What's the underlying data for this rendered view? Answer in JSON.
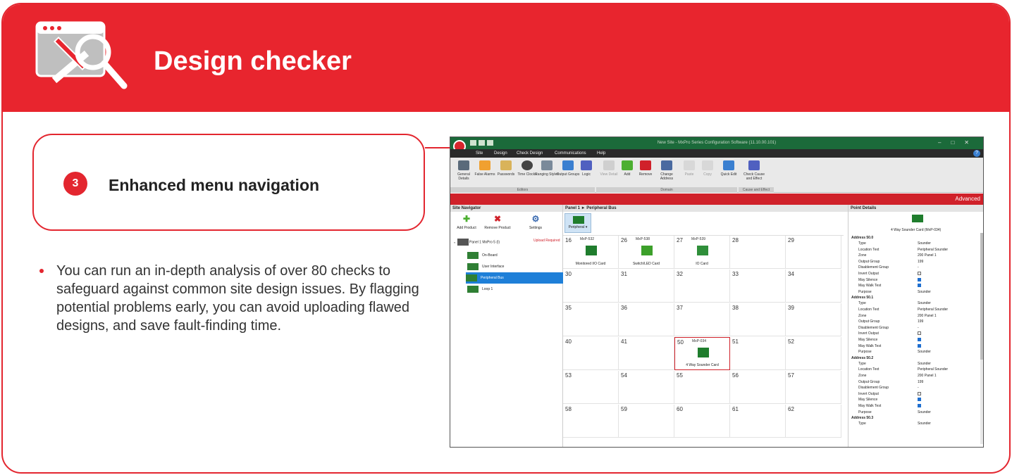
{
  "header": {
    "title": "Design checker",
    "icon": "design-checker-icon"
  },
  "feature": {
    "number": "3",
    "title": "Enhanced menu navigation"
  },
  "bullet": "You can run an in-depth analysis of over 80 checks to safeguard against common site design issues. By flagging potential problems early, you can avoid uploading flawed designs, and save fault-finding time.",
  "colors": {
    "accent": "#e8252e",
    "app_green": "#1b6a3a",
    "selection_blue": "#1e7fd8"
  },
  "app": {
    "window_title": "New Site - MxPro Series Configuration Software (11.10.00.101)",
    "menu": [
      "Site",
      "Design",
      "Check Design",
      "Communications",
      "Help"
    ],
    "ribbon": {
      "buttons": [
        {
          "label": "General Details"
        },
        {
          "label": "False Alarms"
        },
        {
          "label": "Passwords"
        },
        {
          "label": "Time Clocks"
        },
        {
          "label": "Ranging Styles"
        },
        {
          "label": "Output Groups"
        },
        {
          "label": "Logic"
        },
        {
          "label": "View Detail"
        },
        {
          "label": "Add"
        },
        {
          "label": "Remove"
        },
        {
          "label": "Change Address"
        },
        {
          "label": "Paste"
        },
        {
          "label": "Copy"
        },
        {
          "label": "Quick Edit"
        },
        {
          "label": "Check Cause and Effect"
        }
      ],
      "groups": [
        "Editors",
        "Domain",
        "Cause and Effect"
      ]
    },
    "brand": "Advanced",
    "navigator": {
      "title": "Site Navigator",
      "tools": [
        "Add Product",
        "Remove Product",
        "Settings"
      ],
      "panel": "Panel 1",
      "panel_model": "MxPro 5 (I)",
      "upload": "Upload Required",
      "items": [
        "On-Board",
        "User Interface",
        "Peripheral Bus",
        "Loop 1"
      ]
    },
    "center": {
      "breadcrumb": "Panel 1 ► Peripheral Bus",
      "peripheral_btn": "Peripheral ▾",
      "cells": [
        {
          "addr": "16",
          "model": "MxP-532",
          "name": "Monitored I/O Card"
        },
        {
          "addr": "26",
          "model": "MxP-538",
          "name": "Switch/LED Card"
        },
        {
          "addr": "27",
          "model": "MxP-539",
          "name": "IO Card"
        },
        {
          "addr": "28",
          "model": "",
          "name": ""
        },
        {
          "addr": "29",
          "model": "",
          "name": ""
        },
        {
          "addr": "30",
          "model": "",
          "name": ""
        },
        {
          "addr": "31",
          "model": "",
          "name": ""
        },
        {
          "addr": "32",
          "model": "",
          "name": ""
        },
        {
          "addr": "33",
          "model": "",
          "name": ""
        },
        {
          "addr": "34",
          "model": "",
          "name": ""
        },
        {
          "addr": "35",
          "model": "",
          "name": ""
        },
        {
          "addr": "36",
          "model": "",
          "name": ""
        },
        {
          "addr": "37",
          "model": "",
          "name": ""
        },
        {
          "addr": "38",
          "model": "",
          "name": ""
        },
        {
          "addr": "39",
          "model": "",
          "name": ""
        },
        {
          "addr": "40",
          "model": "",
          "name": ""
        },
        {
          "addr": "41",
          "model": "",
          "name": ""
        },
        {
          "addr": "50",
          "model": "MxP-034",
          "name": "4 Way Sounder Card"
        },
        {
          "addr": "51",
          "model": "",
          "name": ""
        },
        {
          "addr": "52",
          "model": "",
          "name": ""
        },
        {
          "addr": "53",
          "model": "",
          "name": ""
        },
        {
          "addr": "54",
          "model": "",
          "name": ""
        },
        {
          "addr": "55",
          "model": "",
          "name": ""
        },
        {
          "addr": "56",
          "model": "",
          "name": ""
        },
        {
          "addr": "57",
          "model": "",
          "name": ""
        },
        {
          "addr": "58",
          "model": "",
          "name": ""
        },
        {
          "addr": "59",
          "model": "",
          "name": ""
        },
        {
          "addr": "60",
          "model": "",
          "name": ""
        },
        {
          "addr": "61",
          "model": "",
          "name": ""
        },
        {
          "addr": "62",
          "model": "",
          "name": ""
        }
      ]
    },
    "details": {
      "title": "Point Details",
      "card_label": "4 Way Sounder Card (MxP-034)",
      "sections": [
        {
          "head": "Address 50.0",
          "props": [
            {
              "k": "Type",
              "v": "Sounder"
            },
            {
              "k": "Location Text",
              "v": "Peripheral Sounder"
            },
            {
              "k": "Zone",
              "v": "200  Panel 1"
            },
            {
              "k": "Output Group",
              "v": "199"
            },
            {
              "k": "Disablement Group",
              "v": "-"
            },
            {
              "k": "Invert Output",
              "v": "off"
            },
            {
              "k": "May Silence",
              "v": "on"
            },
            {
              "k": "May Walk Test",
              "v": "on"
            },
            {
              "k": "Purpose",
              "v": "Sounder"
            }
          ]
        },
        {
          "head": "Address 50.1",
          "props": [
            {
              "k": "Type",
              "v": "Sounder"
            },
            {
              "k": "Location Text",
              "v": "Peripheral Sounder"
            },
            {
              "k": "Zone",
              "v": "200  Panel 1"
            },
            {
              "k": "Output Group",
              "v": "199"
            },
            {
              "k": "Disablement Group",
              "v": "-"
            },
            {
              "k": "Invert Output",
              "v": "off"
            },
            {
              "k": "May Silence",
              "v": "on"
            },
            {
              "k": "May Walk Test",
              "v": "on"
            },
            {
              "k": "Purpose",
              "v": "Sounder"
            }
          ]
        },
        {
          "head": "Address 50.2",
          "props": [
            {
              "k": "Type",
              "v": "Sounder"
            },
            {
              "k": "Location Text",
              "v": "Peripheral Sounder"
            },
            {
              "k": "Zone",
              "v": "200  Panel 1"
            },
            {
              "k": "Output Group",
              "v": "199"
            },
            {
              "k": "Disablement Group",
              "v": "-"
            },
            {
              "k": "Invert Output",
              "v": "off"
            },
            {
              "k": "May Silence",
              "v": "on"
            },
            {
              "k": "May Walk Test",
              "v": "on"
            },
            {
              "k": "Purpose",
              "v": "Sounder"
            }
          ]
        },
        {
          "head": "Address 50.3",
          "props": [
            {
              "k": "Type",
              "v": "Sounder"
            }
          ]
        }
      ]
    }
  }
}
